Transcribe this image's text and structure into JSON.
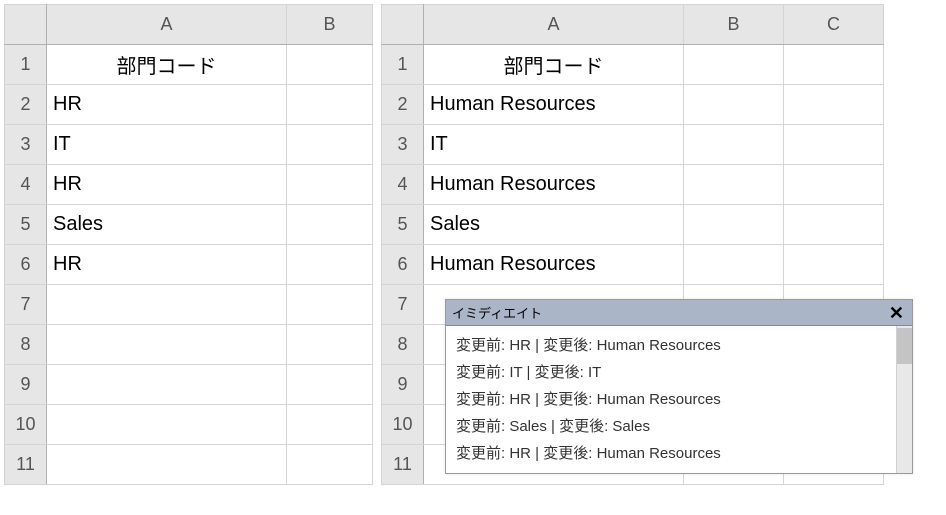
{
  "left": {
    "cols": [
      "A",
      "B"
    ],
    "rowNumbers": [
      "1",
      "2",
      "3",
      "4",
      "5",
      "6",
      "7",
      "8",
      "9",
      "10",
      "11"
    ],
    "header": "部門コード",
    "values": [
      "HR",
      "IT",
      "HR",
      "Sales",
      "HR"
    ]
  },
  "right": {
    "cols": [
      "A",
      "B",
      "C"
    ],
    "rowNumbers": [
      "1",
      "2",
      "3",
      "4",
      "5",
      "6",
      "7",
      "8",
      "9",
      "10",
      "11"
    ],
    "header": "部門コード",
    "values": [
      "Human Resources",
      "IT",
      "Human Resources",
      "Sales",
      "Human Resources"
    ]
  },
  "immediate": {
    "title": "イミディエイト",
    "lines": [
      "変更前: HR | 変更後: Human Resources",
      "変更前: IT | 変更後: IT",
      "変更前: HR | 変更後: Human Resources",
      "変更前: Sales | 変更後: Sales",
      "変更前: HR | 変更後: Human Resources"
    ]
  }
}
